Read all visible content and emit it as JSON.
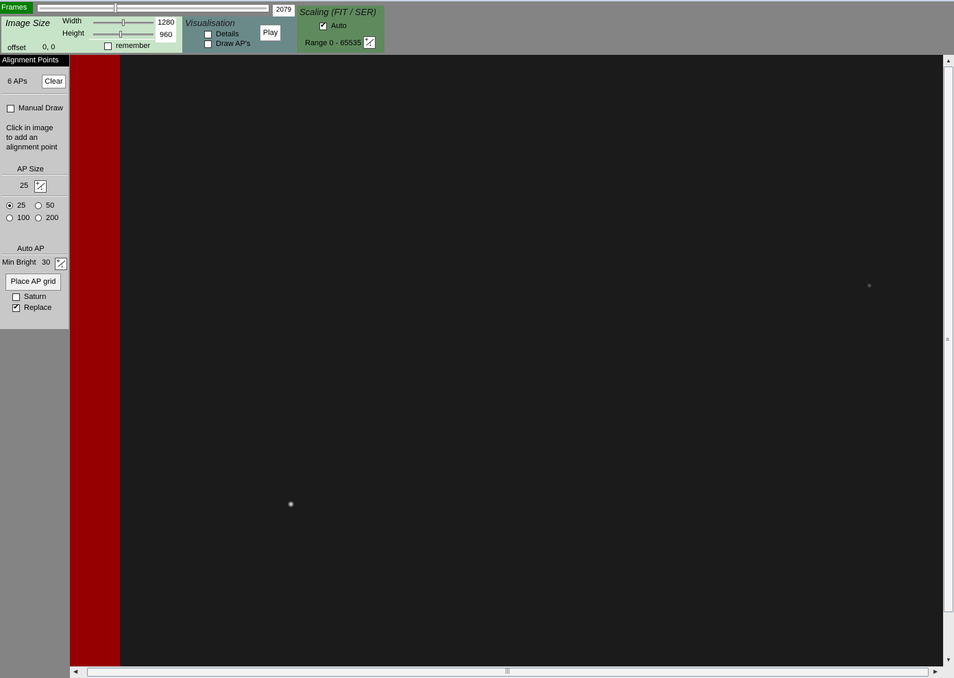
{
  "frames": {
    "tab_label": "Frames",
    "value": "2079",
    "slider_position": 0.33
  },
  "image_size": {
    "title": "Image Size",
    "width_label": "Width",
    "width_value": "1280",
    "height_label": "Height",
    "height_value": "960",
    "remember_label": "remember",
    "remember_checked": false,
    "offset_label": "offset",
    "offset_value": "0, 0"
  },
  "visualisation": {
    "title": "Visualisation",
    "details_label": "Details",
    "draw_aps_label": "Draw AP's",
    "play_label": "Play"
  },
  "scaling": {
    "title": "Scaling (FIT / SER)",
    "auto_label": "Auto",
    "auto_checked": true,
    "range_label": "Range 0 - 65535"
  },
  "alignment_points": {
    "header": "Alignment Points",
    "count_label": "6 APs",
    "clear_label": "Clear",
    "manual_draw_label": "Manual Draw",
    "instructions": [
      "Click in image",
      "to add an",
      "alignment point"
    ],
    "ap_size_title": "AP Size",
    "ap_size_value": "25",
    "size_options": [
      "25",
      "50",
      "100",
      "200"
    ],
    "selected_size": "25",
    "auto_ap_title": "Auto AP",
    "min_bright_label": "Min Bright",
    "min_bright_value": "30",
    "place_grid_label": "Place AP grid",
    "saturn_label": "Saturn",
    "saturn_checked": false,
    "replace_label": "Replace",
    "replace_checked": true
  },
  "colors": {
    "background": "#848484",
    "frames_tab": "#008000",
    "image_size_panel": "#c8e4c8",
    "visualisation_panel": "#6a8a8a",
    "scaling_panel": "#5e8a5e",
    "image_background": "#1b1b1b",
    "red_strip": "#960000"
  }
}
